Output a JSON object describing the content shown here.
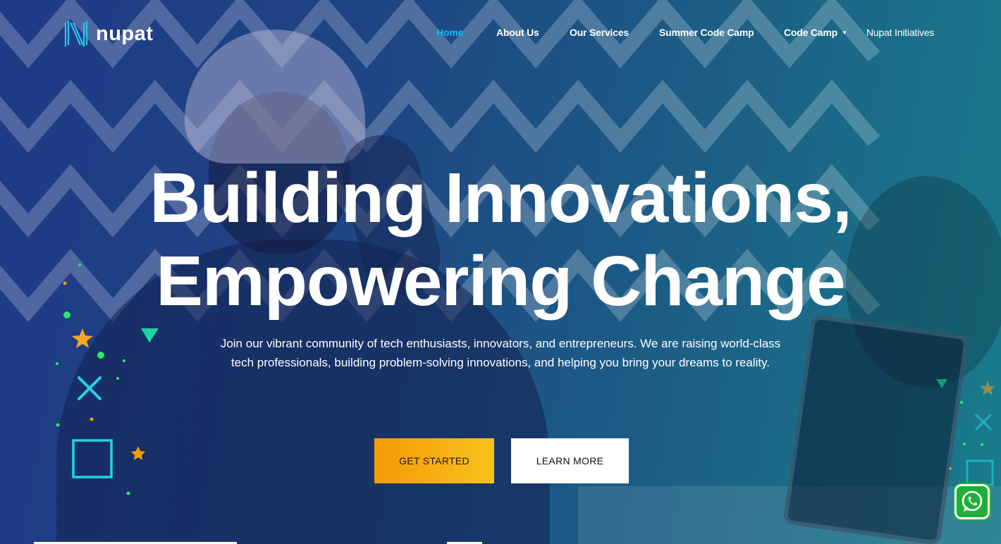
{
  "brand": {
    "name": "nupat",
    "logo_icon": "nupat-n-logo-icon"
  },
  "nav": {
    "items": [
      {
        "label": "Home",
        "active": true
      },
      {
        "label": "About Us",
        "active": false
      },
      {
        "label": "Our Services",
        "active": false
      },
      {
        "label": "Summer Code Camp",
        "active": false
      },
      {
        "label": "Code Camp",
        "active": false,
        "has_dropdown": true
      },
      {
        "label": "Nupat Initiatives",
        "active": false
      }
    ]
  },
  "hero": {
    "headline_line1": "Building Innovations,",
    "headline_line2": "Empowering Change",
    "subtext_line1": "Join our vibrant community of tech enthusiasts, innovators, and entrepreneurs. We are raising world-class",
    "subtext_line2": "tech professionals, building problem-solving innovations, and helping you bring your dreams to reality.",
    "primary_button": "GET STARTED",
    "secondary_button": "LEARN MORE"
  },
  "floating": {
    "chat_icon": "whatsapp-icon"
  },
  "colors": {
    "accent_blue": "#18b8f0",
    "button_orange": "#f59b06",
    "button_yellow": "#f6c21c",
    "whatsapp_green": "#1faf38",
    "deco_cyan": "#22d3e6",
    "deco_green": "#2ee86a"
  }
}
